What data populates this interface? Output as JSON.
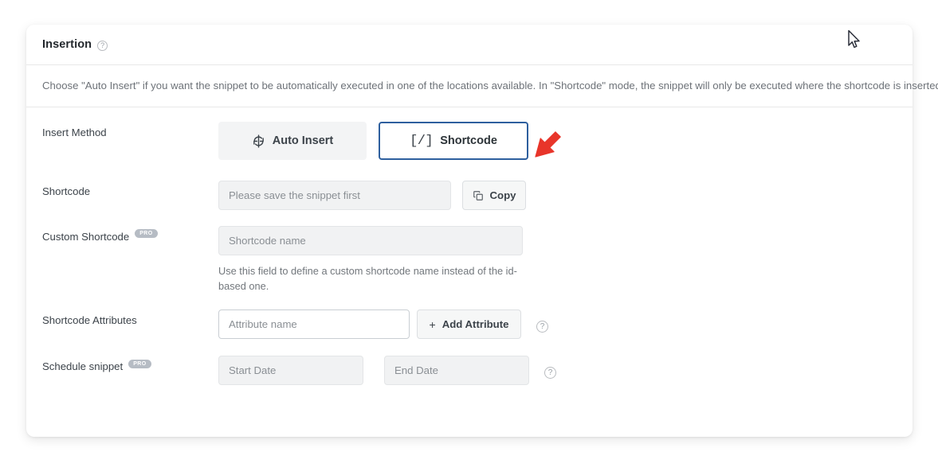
{
  "card": {
    "title": "Insertion",
    "title_help_icon": "question-circle-icon",
    "description": "Choose \"Auto Insert\" if you want the snippet to be automatically executed in one of the locations available. In \"Shortcode\" mode, the snippet will only be executed where the shortcode is inserted."
  },
  "insert_method": {
    "label": "Insert Method",
    "options": [
      {
        "label": "Auto Insert",
        "icon": "sync-arrows-icon",
        "selected": false
      },
      {
        "label": "Shortcode",
        "icon": "square-brackets-slash-icon",
        "selected": true
      }
    ],
    "selected_border_color": "#2e5f9e"
  },
  "shortcode": {
    "label": "Shortcode",
    "value": "Please save the snippet first",
    "copy_button_label": "Copy",
    "copy_button_icon": "copy-icon"
  },
  "custom_shortcode": {
    "label": "Custom Shortcode",
    "badge": "PRO",
    "placeholder": "Shortcode name",
    "hint": "Use this field to define a custom shortcode name instead of the id-based one."
  },
  "shortcode_attributes": {
    "label": "Shortcode Attributes",
    "placeholder": "Attribute name",
    "add_button_label": "Add Attribute",
    "add_button_icon": "plus-icon",
    "plus_glyph": "+",
    "help_icon": "question-circle-icon"
  },
  "schedule_snippet": {
    "label": "Schedule snippet",
    "badge": "PRO",
    "start_placeholder": "Start Date",
    "end_placeholder": "End Date",
    "help_icon": "question-circle-icon"
  },
  "annotations": {
    "arrow": {
      "icon": "red-arrow-icon",
      "color": "#e8352a"
    },
    "cursor": {
      "icon": "mouse-pointer-icon"
    }
  },
  "glyphs": {
    "question_mark": "?",
    "bracket_open": "[",
    "bracket_slash": "/",
    "bracket_close": "]",
    "brackets": "[/]"
  }
}
